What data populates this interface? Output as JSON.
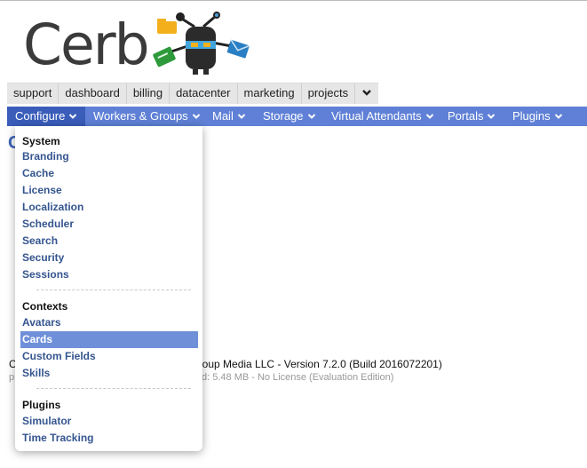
{
  "logo": {
    "text": "Cerb"
  },
  "workspace_tabs": [
    "support",
    "dashboard",
    "billing",
    "datacenter",
    "marketing",
    "projects"
  ],
  "nav": {
    "items": [
      "Configure",
      "Workers & Groups",
      "Mail",
      "Storage",
      "Virtual Attendants",
      "Portals",
      "Plugins"
    ]
  },
  "page": {
    "title_fragment": "C",
    "footer_line1_start": "C",
    "footer_line1_rest": "group Media LLC - Version 7.2.0 (Build 2016072201)",
    "footer_line2_start": "p",
    "footer_line2_rest": "d: 5.48 MB - No License (Evaluation Edition)"
  },
  "menu": {
    "sections": [
      {
        "heading": "System",
        "items": [
          "Branding",
          "Cache",
          "License",
          "Localization",
          "Scheduler",
          "Search",
          "Security",
          "Sessions"
        ]
      },
      {
        "heading": "Contexts",
        "items": [
          "Avatars",
          "Cards",
          "Custom Fields",
          "Skills"
        ]
      },
      {
        "heading": "Plugins",
        "items": [
          "Simulator",
          "Time Tracking"
        ]
      }
    ],
    "selected_item": "Cards"
  },
  "colors": {
    "nav_bg": "#5f80d6",
    "nav_active": "#3a5dba",
    "menu_link": "#34558f",
    "menu_selected_bg": "#6f8fd9"
  }
}
